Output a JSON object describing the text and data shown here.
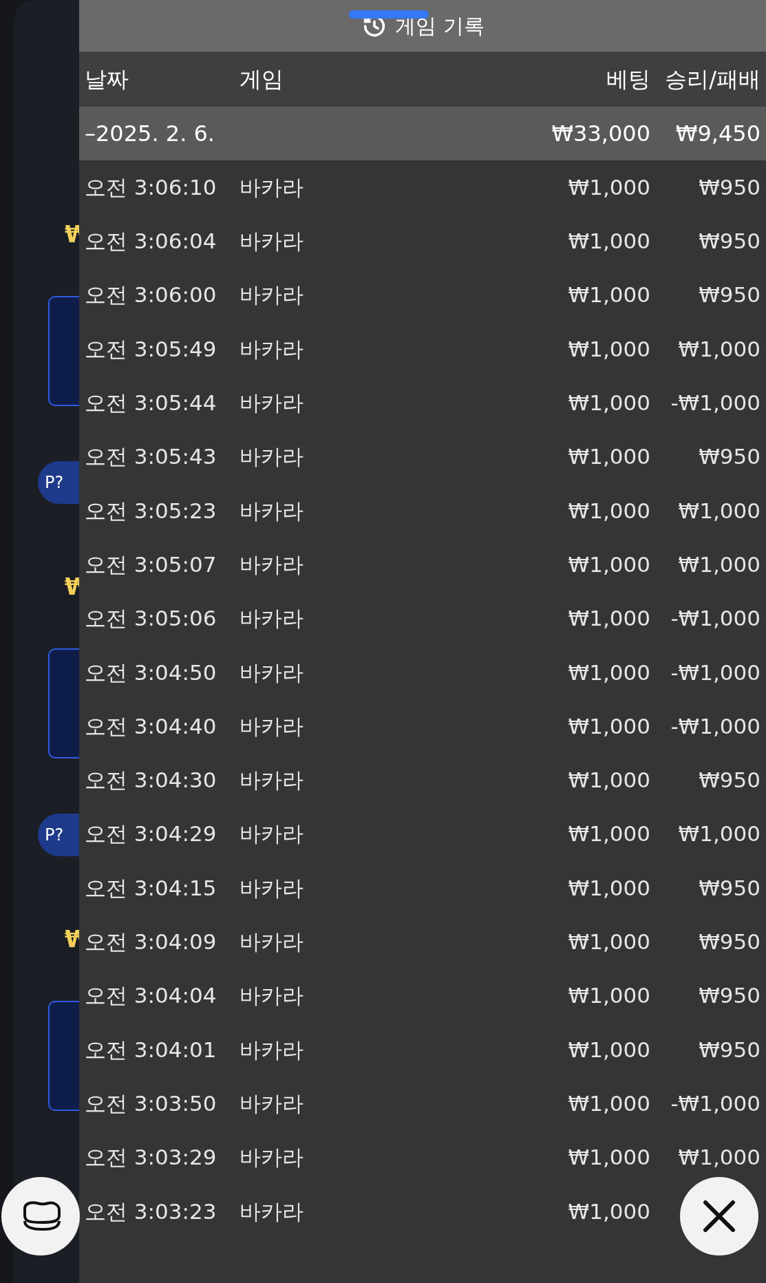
{
  "background": {
    "badges": [
      {
        "kind": "won",
        "text": "₩"
      },
      {
        "kind": "p",
        "text": "P?"
      },
      {
        "kind": "won",
        "text": "₩"
      },
      {
        "kind": "p",
        "text": "P?"
      },
      {
        "kind": "won",
        "text": "₩"
      }
    ]
  },
  "sheet": {
    "title": "게임 기록",
    "columns": [
      "날짜",
      "게임",
      "베팅",
      "승리/패배"
    ],
    "summary": {
      "date": "–2025. 2. 6.",
      "bet": "₩33,000",
      "result": "₩9,450"
    },
    "rows": [
      {
        "time": "오전 3:06:10",
        "game": "바카라",
        "bet": "₩1,000",
        "result": "₩950"
      },
      {
        "time": "오전 3:06:04",
        "game": "바카라",
        "bet": "₩1,000",
        "result": "₩950"
      },
      {
        "time": "오전 3:06:00",
        "game": "바카라",
        "bet": "₩1,000",
        "result": "₩950"
      },
      {
        "time": "오전 3:05:49",
        "game": "바카라",
        "bet": "₩1,000",
        "result": "₩1,000"
      },
      {
        "time": "오전 3:05:44",
        "game": "바카라",
        "bet": "₩1,000",
        "result": "-₩1,000"
      },
      {
        "time": "오전 3:05:43",
        "game": "바카라",
        "bet": "₩1,000",
        "result": "₩950"
      },
      {
        "time": "오전 3:05:23",
        "game": "바카라",
        "bet": "₩1,000",
        "result": "₩1,000"
      },
      {
        "time": "오전 3:05:07",
        "game": "바카라",
        "bet": "₩1,000",
        "result": "₩1,000"
      },
      {
        "time": "오전 3:05:06",
        "game": "바카라",
        "bet": "₩1,000",
        "result": "-₩1,000"
      },
      {
        "time": "오전 3:04:50",
        "game": "바카라",
        "bet": "₩1,000",
        "result": "-₩1,000"
      },
      {
        "time": "오전 3:04:40",
        "game": "바카라",
        "bet": "₩1,000",
        "result": "-₩1,000"
      },
      {
        "time": "오전 3:04:30",
        "game": "바카라",
        "bet": "₩1,000",
        "result": "₩950"
      },
      {
        "time": "오전 3:04:29",
        "game": "바카라",
        "bet": "₩1,000",
        "result": "₩1,000"
      },
      {
        "time": "오전 3:04:15",
        "game": "바카라",
        "bet": "₩1,000",
        "result": "₩950"
      },
      {
        "time": "오전 3:04:09",
        "game": "바카라",
        "bet": "₩1,000",
        "result": "₩950"
      },
      {
        "time": "오전 3:04:04",
        "game": "바카라",
        "bet": "₩1,000",
        "result": "₩950"
      },
      {
        "time": "오전 3:04:01",
        "game": "바카라",
        "bet": "₩1,000",
        "result": "₩950"
      },
      {
        "time": "오전 3:03:50",
        "game": "바카라",
        "bet": "₩1,000",
        "result": "-₩1,000"
      },
      {
        "time": "오전 3:03:29",
        "game": "바카라",
        "bet": "₩1,000",
        "result": "₩1,000"
      },
      {
        "time": "오전 3:03:23",
        "game": "바카라",
        "bet": "₩1,000"
      }
    ]
  }
}
